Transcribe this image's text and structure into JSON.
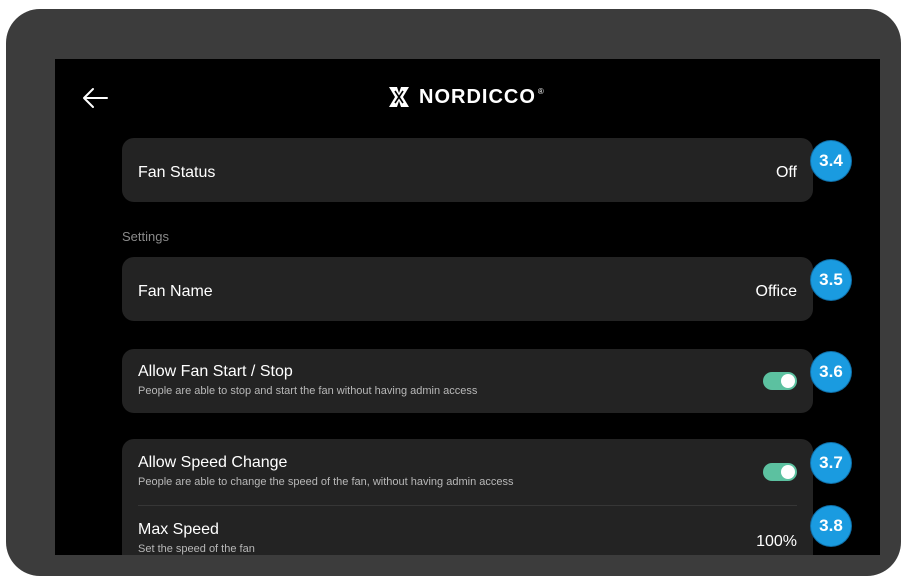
{
  "header": {
    "back_icon": "arrow-left-icon",
    "logo_icon": "nordicco-logo-icon",
    "brand": "NORDICCO",
    "brand_mark": "®"
  },
  "fan_status": {
    "title": "Fan Status",
    "value": "Off"
  },
  "settings": {
    "section_label": "Settings",
    "fan_name": {
      "title": "Fan Name",
      "value": "Office"
    },
    "allow_start_stop": {
      "title": "Allow Fan Start / Stop",
      "subtitle": "People are able to stop and start the fan without having admin access",
      "enabled": true
    },
    "allow_speed_change": {
      "title": "Allow Speed Change",
      "subtitle": "People are able to change the speed of the fan, without having admin access",
      "enabled": true
    },
    "max_speed": {
      "title": "Max Speed",
      "subtitle": "Set the speed of the fan",
      "value": "100%"
    }
  },
  "badges": [
    "3.4",
    "3.5",
    "3.6",
    "3.7",
    "3.8"
  ],
  "colors": {
    "toggle_on": "#5cc1a0",
    "badge": "#1a9be0",
    "card": "#232323",
    "screen": "#000000",
    "bezel": "#3c3c3c"
  }
}
